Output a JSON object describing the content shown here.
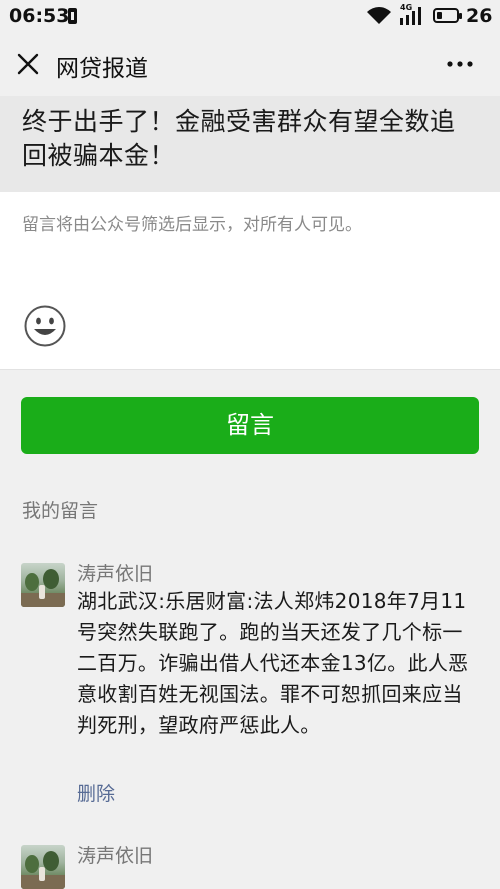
{
  "status_bar": {
    "time": "06:53",
    "network": "4G",
    "battery_level": "26",
    "battery_fraction": 0.26
  },
  "nav": {
    "title": "网贷报道",
    "close_icon": "close-icon",
    "more_icon": "more-icon"
  },
  "article": {
    "title": "终于出手了！金融受害群众有望全数追回被骗本金！"
  },
  "comment_box": {
    "placeholder": "留言将由公众号筛选后显示，对所有人可见。",
    "emoji_icon": "emoji-icon"
  },
  "submit": {
    "label": "留言",
    "color": "#1aad19"
  },
  "my_comments": {
    "label": "我的留言",
    "items": [
      {
        "author": "涛声依旧",
        "text": "湖北武汉:乐居财富:法人郑炜2018年7月11号突然失联跑了。跑的当天还发了几个标一二百万。诈骗出借人代还本金13亿。此人恶意收割百姓无视国法。罪不可恕抓回来应当判死刑，望政府严惩此人。",
        "delete_label": "删除"
      },
      {
        "author": "涛声依旧"
      }
    ]
  },
  "colors": {
    "link": "#576b95",
    "accent": "#1aad19"
  }
}
